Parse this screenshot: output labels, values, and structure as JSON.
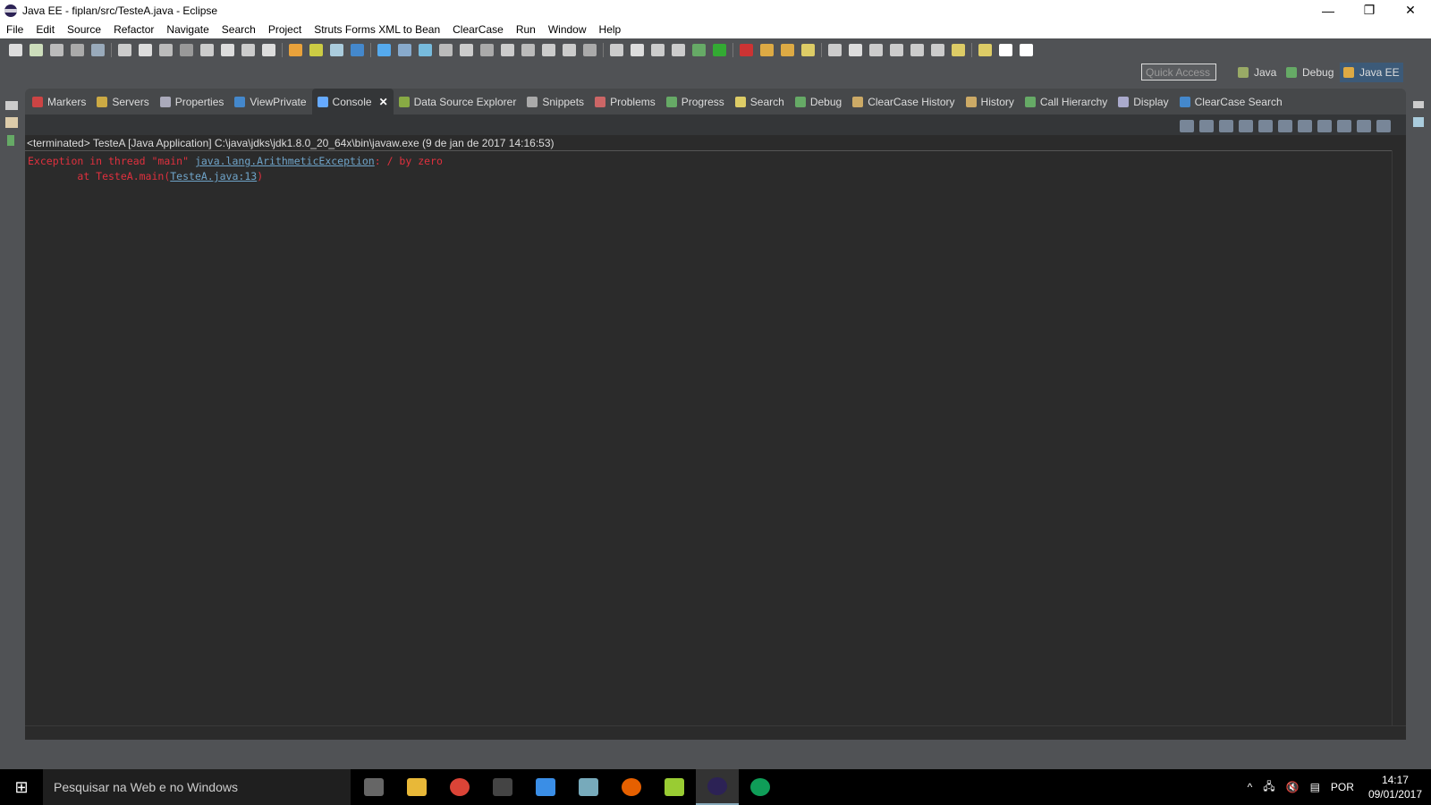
{
  "window": {
    "title": "Java EE - fiplan/src/TesteA.java - Eclipse",
    "minimize": "—",
    "restore": "❐",
    "close": "✕"
  },
  "menu": [
    "File",
    "Edit",
    "Source",
    "Refactor",
    "Navigate",
    "Search",
    "Project",
    "Struts Forms XML to Bean",
    "ClearCase",
    "Run",
    "Window",
    "Help"
  ],
  "toolbar": {
    "quick_access_placeholder": "Quick Access",
    "perspectives": [
      {
        "label": "Java",
        "color": "#9a6"
      },
      {
        "label": "Debug",
        "color": "#6a6"
      },
      {
        "label": "Java EE",
        "color": "#da4"
      }
    ]
  },
  "toolbar_icons": [
    "new-icon",
    "new-project-icon",
    "save-icon",
    "save-all-icon",
    "skip-breakpoints-icon",
    "resume-icon",
    "suspend-icon",
    "terminate-icon",
    "disconnect-icon",
    "step-into-icon",
    "step-over-icon",
    "step-return-icon",
    "drop-frame-icon",
    "use-step-filters-icon",
    "server-icon",
    "new-server-icon",
    "web-service-icon",
    "globe-icon",
    "browser-icon",
    "db-icon",
    "table-icon",
    "column-icon",
    "view-icon",
    "index-icon",
    "layout-icon",
    "zoom-icon",
    "hierarchy-icon",
    "filter-icon",
    "pin-icon",
    "tag-icon",
    "deploy-icon",
    "lock-icon",
    "bug-icon",
    "run-icon",
    "external-tools-icon",
    "open-type-icon",
    "open-task-icon",
    "search-icon",
    "annotation-icon",
    "pen-icon",
    "link-icon",
    "layout-panel-icon",
    "split-icon",
    "next-annotation-icon",
    "prev-annotation-icon",
    "last-edit-icon",
    "back-icon",
    "forward-icon"
  ],
  "tabs": [
    {
      "label": "Markers",
      "color": "#c44"
    },
    {
      "label": "Servers",
      "color": "#ca4"
    },
    {
      "label": "Properties",
      "color": "#aab"
    },
    {
      "label": "ViewPrivate",
      "color": "#48c"
    },
    {
      "label": "Console",
      "color": "#6af",
      "active": true
    },
    {
      "label": "Data Source Explorer",
      "color": "#8a4"
    },
    {
      "label": "Snippets",
      "color": "#aaa"
    },
    {
      "label": "Problems",
      "color": "#c66"
    },
    {
      "label": "Progress",
      "color": "#6a6"
    },
    {
      "label": "Search",
      "color": "#dc6"
    },
    {
      "label": "Debug",
      "color": "#6a6"
    },
    {
      "label": "ClearCase History",
      "color": "#ca6"
    },
    {
      "label": "History",
      "color": "#ca6"
    },
    {
      "label": "Call Hierarchy",
      "color": "#6a6"
    },
    {
      "label": "Display",
      "color": "#aac"
    },
    {
      "label": "ClearCase Search",
      "color": "#48c"
    }
  ],
  "console": {
    "process": "<terminated> TesteA [Java Application] C:\\java\\jdks\\jdk1.8.0_20_64x\\bin\\javaw.exe (9 de jan de 2017 14:16:53)",
    "line1_prefix": "Exception in thread \"main\" ",
    "line1_link": "java.lang.ArithmeticException",
    "line1_suffix": ": / by zero",
    "line2_prefix": "\tat TesteA.main(",
    "line2_link": "TesteA.java:13",
    "line2_suffix": ")"
  },
  "taskbar": {
    "search_placeholder": "Pesquisar na Web e no Windows",
    "apps": [
      {
        "name": "task-view",
        "color": "#666"
      },
      {
        "name": "file-explorer",
        "color": "#e8b838"
      },
      {
        "name": "chrome",
        "color": "#db4437"
      },
      {
        "name": "terminal",
        "color": "#444"
      },
      {
        "name": "media-app",
        "color": "#3a8ee6"
      },
      {
        "name": "search-app",
        "color": "#7ab"
      },
      {
        "name": "firefox",
        "color": "#e66000"
      },
      {
        "name": "notepad",
        "color": "#9c3"
      },
      {
        "name": "eclipse",
        "color": "#2c2255",
        "active": true
      },
      {
        "name": "hangouts",
        "color": "#0f9d58"
      }
    ],
    "tray": {
      "language": "POR",
      "time": "14:17",
      "date": "09/01/2017"
    }
  }
}
